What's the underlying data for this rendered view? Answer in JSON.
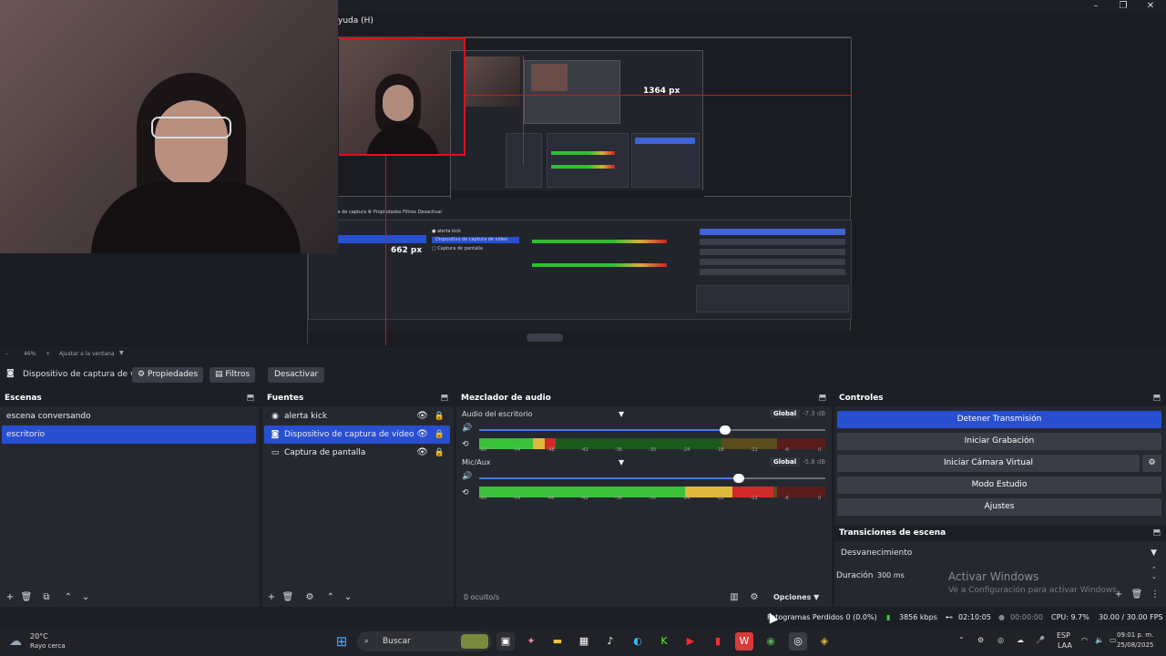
{
  "menu": {
    "help_partial": "yuda (H)"
  },
  "preview": {
    "width_readout": "1364 px",
    "height_readout": "662 px"
  },
  "zoom": {
    "level": "46%",
    "fit_label": "Ajustar a la ventana"
  },
  "source_toolbar": {
    "source_name": "Dispositivo de captura de v",
    "properties": "Propiedades",
    "filters": "Filtros",
    "deactivate": "Desactivar"
  },
  "scenes": {
    "title": "Escenas",
    "items": [
      {
        "label": "escena conversando",
        "selected": false
      },
      {
        "label": "escritorio",
        "selected": true
      }
    ]
  },
  "sources": {
    "title": "Fuentes",
    "items": [
      {
        "label": "alerta kick",
        "icon": "globe-icon",
        "selected": false
      },
      {
        "label": "Dispositivo de captura de vídeo",
        "icon": "camera-icon",
        "selected": true
      },
      {
        "label": "Captura de pantalla",
        "icon": "monitor-icon",
        "selected": false
      }
    ]
  },
  "mixer": {
    "title": "Mezclador de audio",
    "channels": [
      {
        "name": "Audio del escritorio",
        "global": "Global",
        "db": "-7.3 dB",
        "volume": 0.71,
        "level": 0.22
      },
      {
        "name": "Mic/Aux",
        "global": "Global",
        "db": "-5.8 dB",
        "volume": 0.75,
        "level": 0.85
      }
    ],
    "scale": [
      "-60",
      "-54",
      "-48",
      "-42",
      "-36",
      "-30",
      "-24",
      "-18",
      "-12",
      "-6",
      "0"
    ],
    "hidden_count": "0 oculto/s",
    "options": "Opciones"
  },
  "controls": {
    "title": "Controles",
    "stop_stream": "Detener Transmisión",
    "start_recording": "Iniciar Grabación",
    "start_virtual_cam": "Iniciar Cámara Virtual",
    "studio_mode": "Modo Estudio",
    "settings": "Ajustes"
  },
  "transitions": {
    "title": "Transiciones de escena",
    "selected": "Desvanecimiento",
    "duration_label": "Duración",
    "duration_value": "300 ms"
  },
  "watermark": {
    "line1": "Activar Windows",
    "line2": "Ve a Configuración para activar Windows."
  },
  "status": {
    "dropped_frames": "Fotogramas Perdidos 0 (0.0%)",
    "bitrate": "3856 kbps",
    "stream_time": "02:10:05",
    "rec_time": "00:00:00",
    "cpu": "CPU: 9.7%",
    "fps": "30.00 / 30.00 FPS"
  },
  "taskbar": {
    "weather_temp": "20°C",
    "weather_desc": "Rayo cerca",
    "search_placeholder": "Buscar",
    "lang_top": "ESP",
    "lang_bottom": "LAA",
    "time": "09:01 p. m.",
    "date": "25/08/2025"
  },
  "colors": {
    "accent_blue": "#284fd1",
    "meter_green": "#39c139",
    "meter_yellow": "#e0b93a",
    "meter_red": "#d02a2a",
    "guide_red": "#e0101a"
  }
}
